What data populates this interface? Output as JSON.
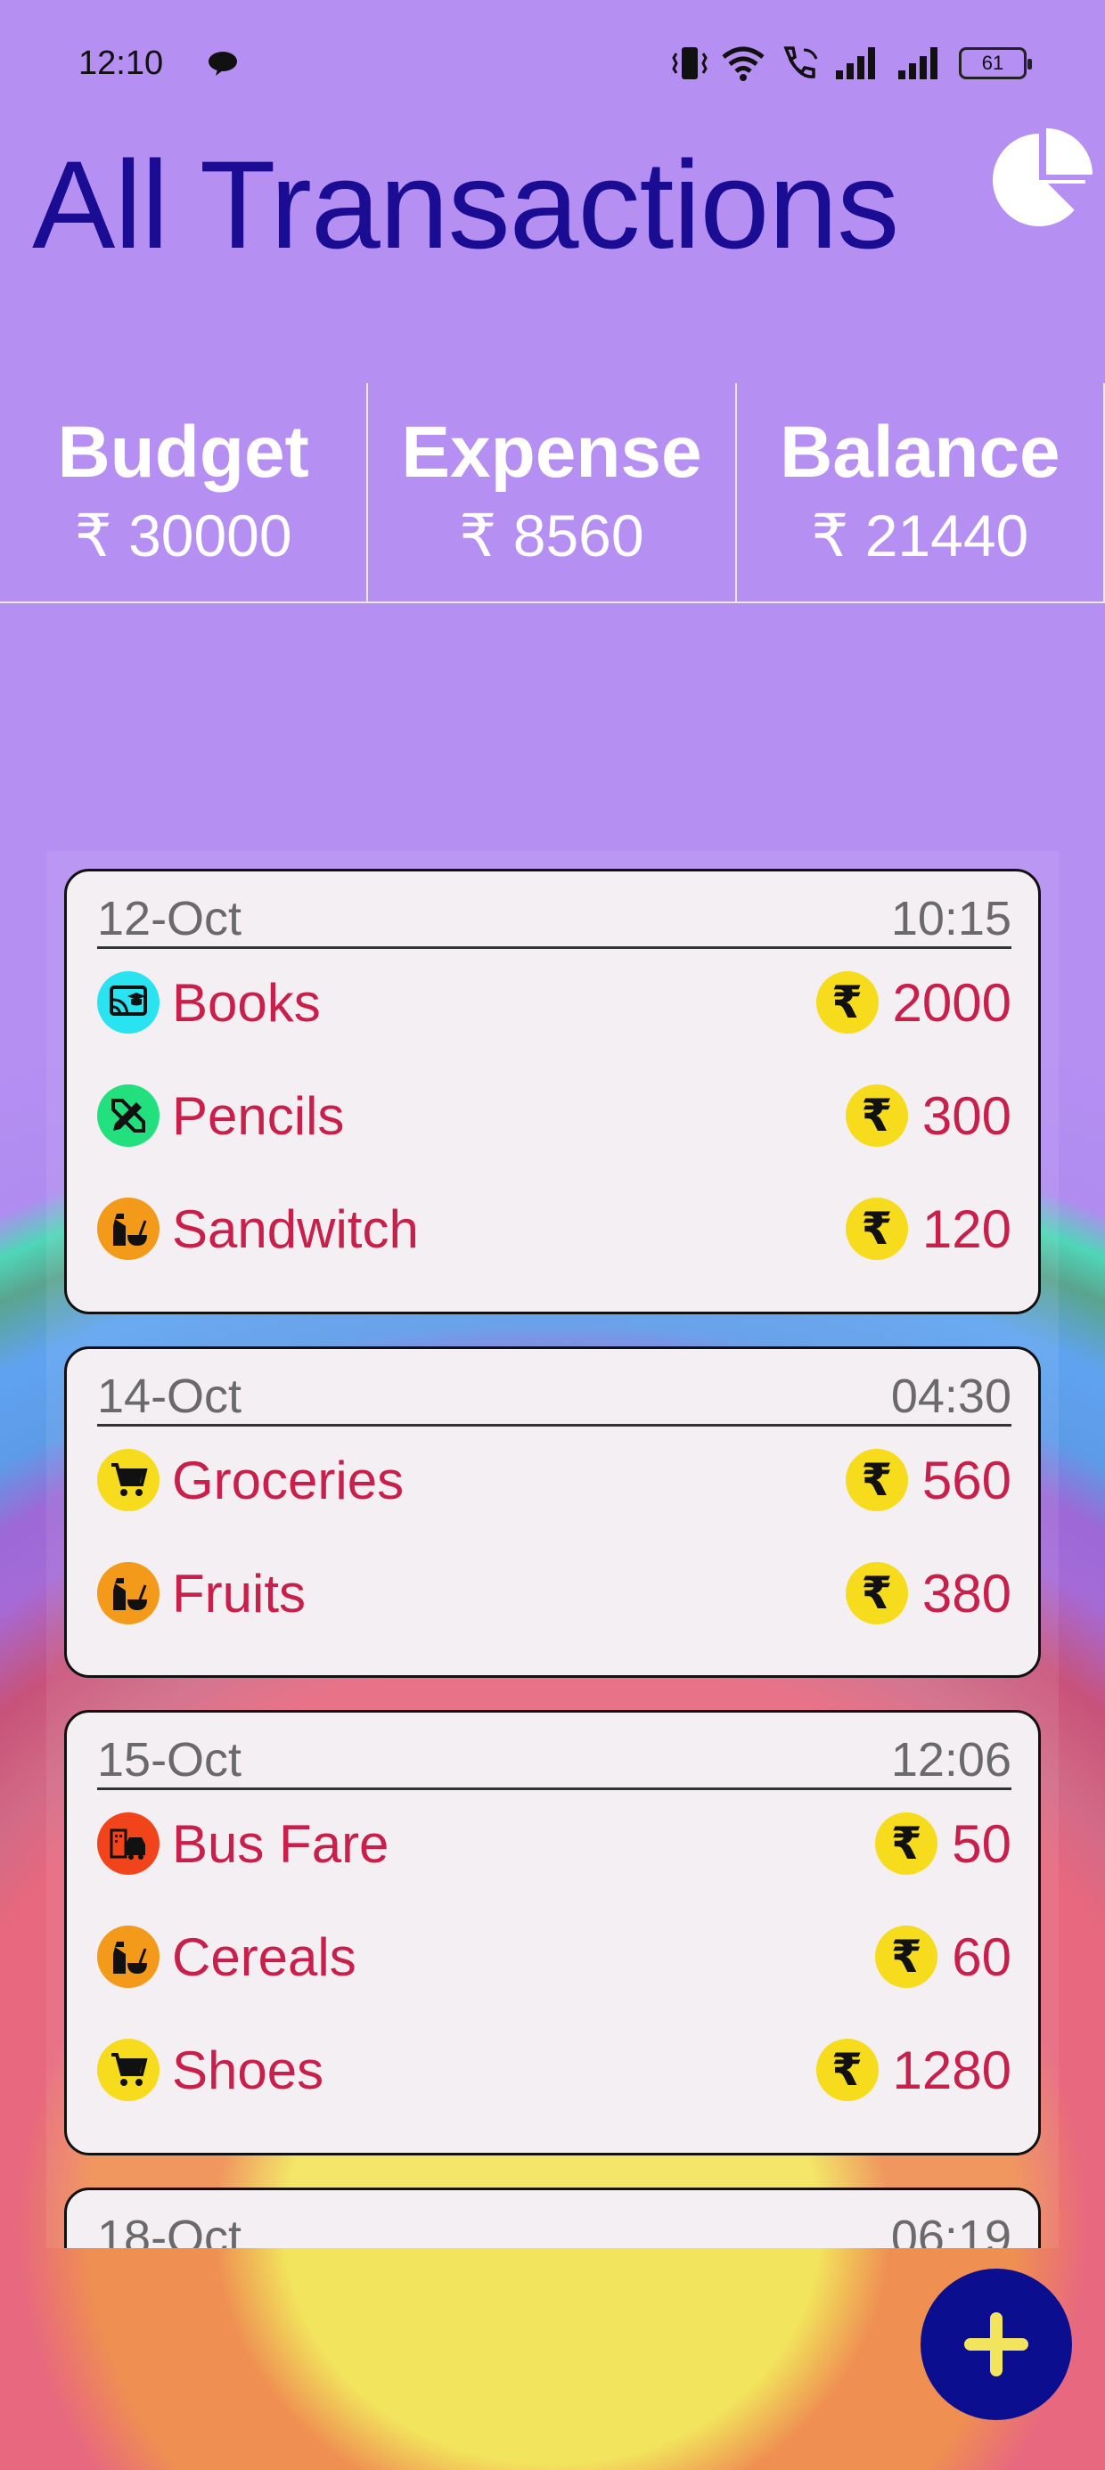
{
  "status_bar": {
    "time": "12:10",
    "battery": "61"
  },
  "header": {
    "title": "All Transactions",
    "chart_button_icon": "pie-chart-icon"
  },
  "summary": [
    {
      "label": "Budget",
      "value": "₹ 30000"
    },
    {
      "label": "Expense",
      "value": "₹ 8560"
    },
    {
      "label": "Balance",
      "value": "₹ 21440"
    }
  ],
  "groups": [
    {
      "date": "12-Oct",
      "time": "10:15",
      "items": [
        {
          "name": "Books",
          "amount": "2000",
          "icon": "books-icon",
          "color": "#29e3f0"
        },
        {
          "name": "Pencils",
          "amount": "300",
          "icon": "pencil-ruler-icon",
          "color": "#22e07d"
        },
        {
          "name": "Sandwitch",
          "amount": "120",
          "icon": "food-icon",
          "color": "#f39a1a"
        }
      ]
    },
    {
      "date": "14-Oct",
      "time": "04:30",
      "items": [
        {
          "name": "Groceries",
          "amount": "560",
          "icon": "cart-icon",
          "color": "#f6dc1d"
        },
        {
          "name": "Fruits",
          "amount": "380",
          "icon": "food-icon",
          "color": "#f39a1a"
        }
      ]
    },
    {
      "date": "15-Oct",
      "time": "12:06",
      "items": [
        {
          "name": "Bus Fare",
          "amount": "50",
          "icon": "transport-icon",
          "color": "#f2441a"
        },
        {
          "name": "Cereals",
          "amount": "60",
          "icon": "food-icon",
          "color": "#f39a1a"
        },
        {
          "name": "Shoes",
          "amount": "1280",
          "icon": "cart-icon",
          "color": "#f6dc1d"
        }
      ]
    },
    {
      "date": "18-Oct",
      "time": "06:19",
      "items": []
    }
  ],
  "currency_symbol": "₹",
  "fab": {
    "icon": "add-icon"
  }
}
